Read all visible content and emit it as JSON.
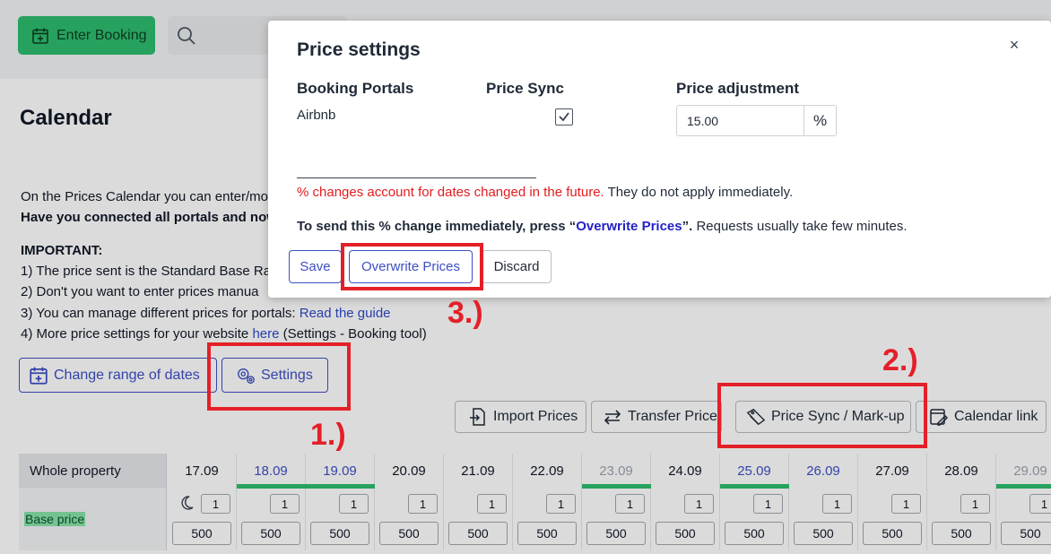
{
  "topbar": {
    "enter_booking": "Enter Booking",
    "search_placeholder": ""
  },
  "page": {
    "title": "Calendar",
    "intro_line1": "On the Prices Calendar you can enter/mo",
    "intro_line2": "Have you connected all portals and now",
    "important_label": "IMPORTANT:",
    "item1": "1) The price sent is the Standard Base Ra",
    "item2": "2) Don't you want to enter prices manua",
    "item3_prefix": "3) You can manage different prices for portals: ",
    "item3_link": "Read the guide",
    "item4_prefix": "4) More price settings for your website ",
    "item4_link": "here",
    "item4_suffix": " (Settings - Booking tool)"
  },
  "buttons": {
    "change_range": "Change range of dates",
    "settings": "Settings",
    "import_prices": "Import Prices",
    "transfer_prices": "Transfer Prices",
    "price_sync": "Price Sync / Mark-up",
    "calendar_link": "Calendar link"
  },
  "calendar": {
    "head_label": "Whole property",
    "row_label": "Base price",
    "columns": [
      {
        "date": "17.09",
        "style": "normal",
        "bar": false,
        "min": "1",
        "price": "500"
      },
      {
        "date": "18.09",
        "style": "weekend",
        "bar": true,
        "min": "1",
        "price": "500"
      },
      {
        "date": "19.09",
        "style": "weekend",
        "bar": true,
        "min": "1",
        "price": "500"
      },
      {
        "date": "20.09",
        "style": "normal",
        "bar": false,
        "min": "1",
        "price": "500"
      },
      {
        "date": "21.09",
        "style": "normal",
        "bar": false,
        "min": "1",
        "price": "500"
      },
      {
        "date": "22.09",
        "style": "normal",
        "bar": false,
        "min": "1",
        "price": "500"
      },
      {
        "date": "23.09",
        "style": "past",
        "bar": true,
        "min": "1",
        "price": "500"
      },
      {
        "date": "24.09",
        "style": "normal",
        "bar": false,
        "min": "1",
        "price": "500"
      },
      {
        "date": "25.09",
        "style": "weekend",
        "bar": true,
        "min": "1",
        "price": "500"
      },
      {
        "date": "26.09",
        "style": "weekend",
        "bar": false,
        "min": "1",
        "price": "500"
      },
      {
        "date": "27.09",
        "style": "normal",
        "bar": false,
        "min": "1",
        "price": "500"
      },
      {
        "date": "28.09",
        "style": "normal",
        "bar": false,
        "min": "1",
        "price": "500"
      },
      {
        "date": "29.09",
        "style": "past",
        "bar": true,
        "min": "1",
        "price": "500"
      }
    ]
  },
  "modal": {
    "title": "Price settings",
    "close": "×",
    "col_portals": "Booking Portals",
    "col_sync": "Price Sync",
    "col_adjust": "Price adjustment",
    "portal_name": "Airbnb",
    "sync_checked": true,
    "adjust_value": "15.00",
    "adjust_unit": "%",
    "note1_red": "% changes account for dates changed in the future.",
    "note1_rest": " They do not apply immediately.",
    "note2_bold": "To send this % change immediately, press “",
    "note2_blue": "Overwrite Prices",
    "note2_bold_end": "”.",
    "note2_rest": " Requests usually take few minutes.",
    "save": "Save",
    "overwrite": "Overwrite Prices",
    "discard": "Discard"
  },
  "annotations": {
    "step1": "1.)",
    "step2": "2.)",
    "step3": "3.)",
    "color": "#e32028"
  },
  "colors": {
    "accent": "#3d4fc4",
    "green": "#2dbd6e",
    "warning": "#e11d1d"
  }
}
